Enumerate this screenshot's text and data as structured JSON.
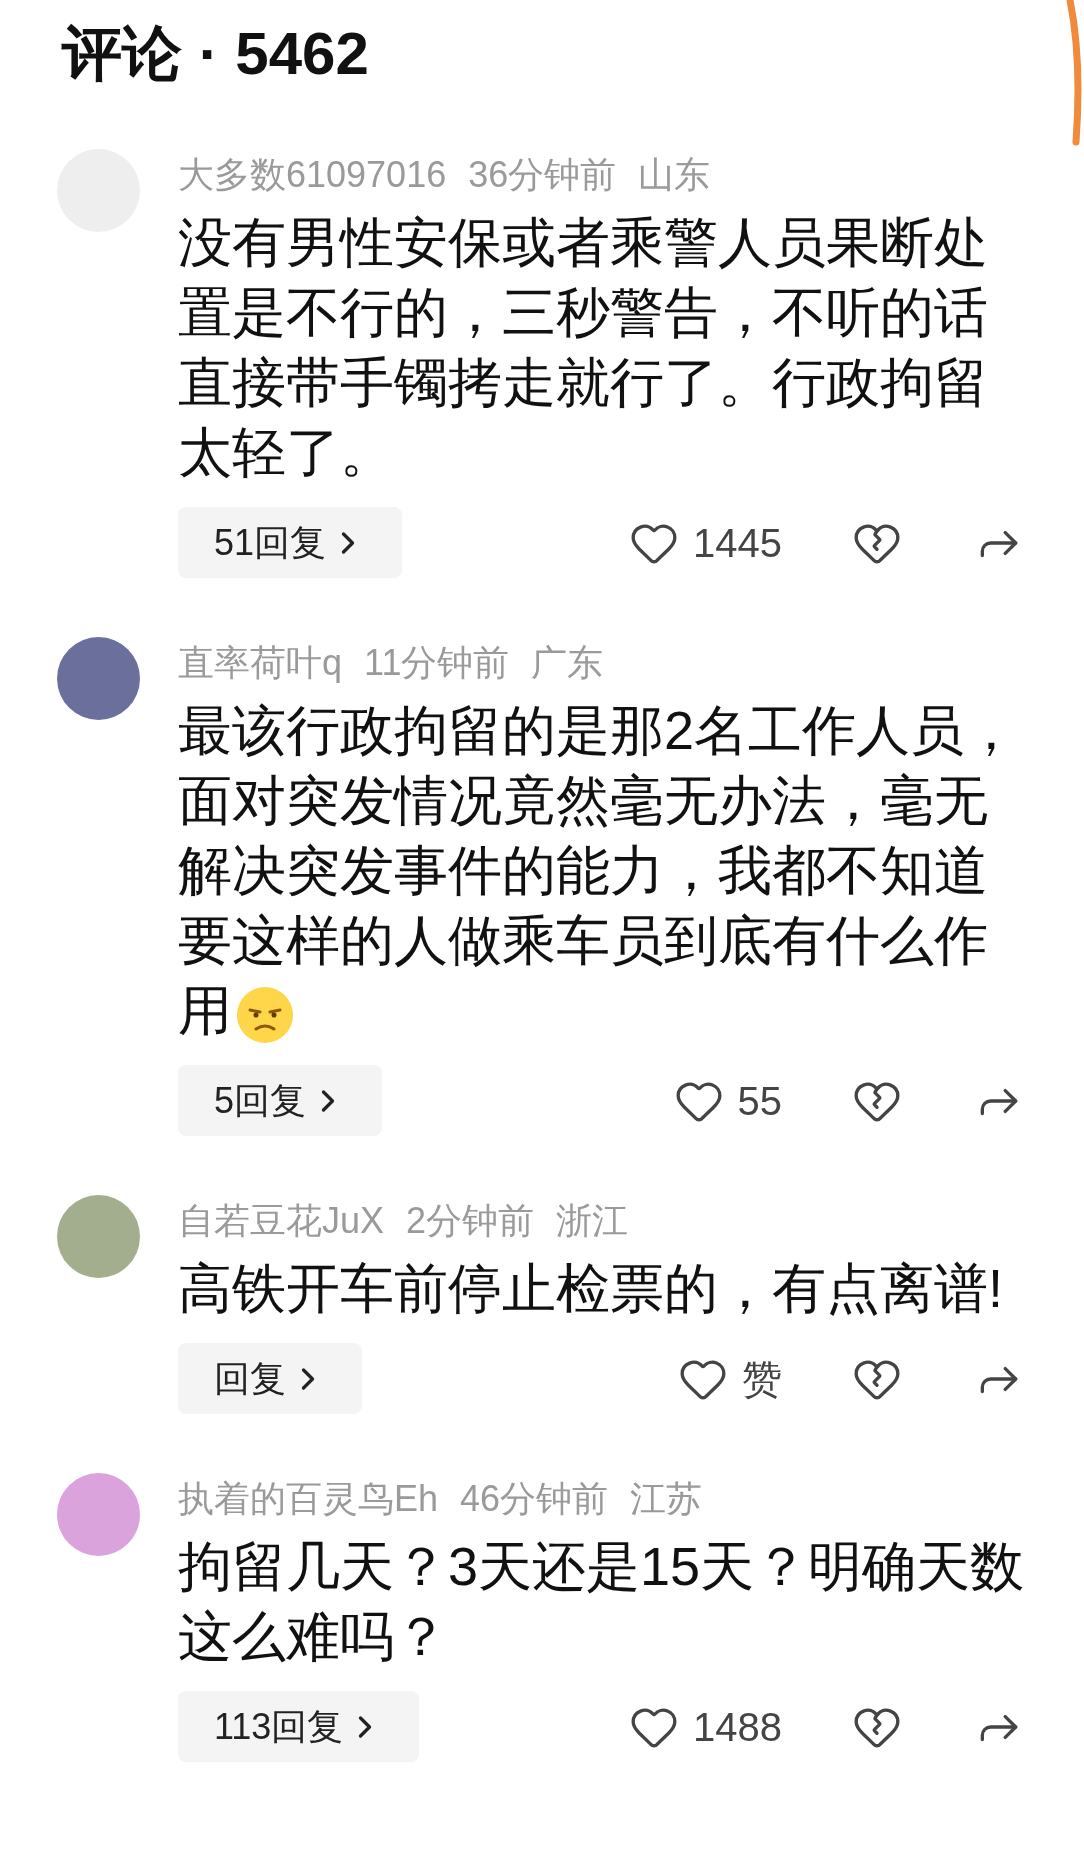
{
  "header": {
    "title": "评论 · 5462"
  },
  "comments": [
    {
      "color": "#eeeeee",
      "name": "大多数61097016",
      "time": "36分钟前",
      "region": "山东",
      "body": "没有男性安保或者乘警人员果断处置是不行的，三秒警告，不听的话直接带手镯拷走就行了。行政拘留太轻了。",
      "has_emoji": false,
      "replies": "51回复",
      "likes": "1445"
    },
    {
      "color": "#6b6f9c",
      "name": "直率荷叶q",
      "time": "11分钟前",
      "region": "广东",
      "body": "最该行政拘留的是那2名工作人员，面对突发情况竟然毫无办法，毫无解决突发事件的能力，我都不知道要这样的人做乘车员到底有什么作用",
      "has_emoji": true,
      "replies": "5回复",
      "likes": "55"
    },
    {
      "color": "#a3ae8e",
      "name": "自若豆花JuX",
      "time": "2分钟前",
      "region": "浙江",
      "body": "高铁开车前停止检票的，有点离谱!",
      "has_emoji": false,
      "replies": "回复",
      "likes": "赞"
    },
    {
      "color": "#dba3dc",
      "name": "执着的百灵鸟Eh",
      "time": "46分钟前",
      "region": "江苏",
      "body": "拘留几天？3天还是15天？明确天数这么难吗？",
      "has_emoji": false,
      "replies": "113回复",
      "likes": "1488"
    }
  ]
}
